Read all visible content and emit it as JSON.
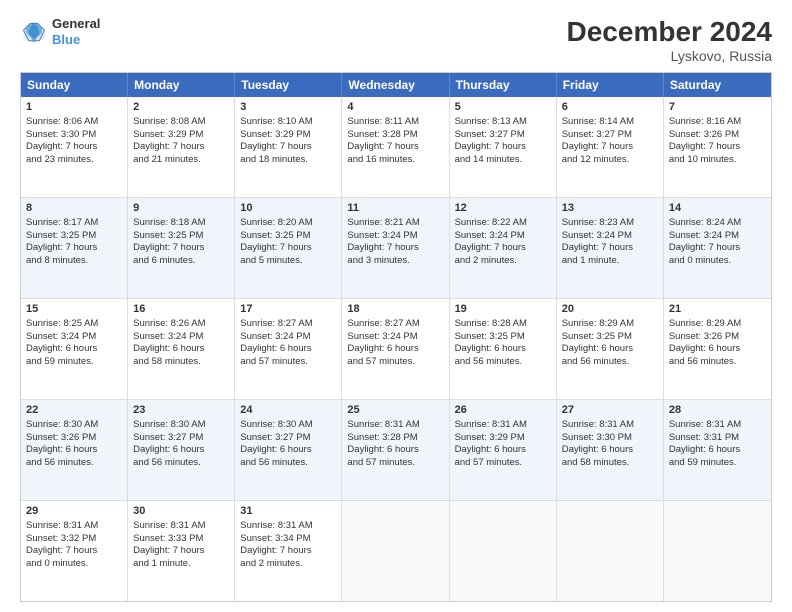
{
  "logo": {
    "line1": "General",
    "line2": "Blue"
  },
  "title": "December 2024",
  "subtitle": "Lyskovo, Russia",
  "headers": [
    "Sunday",
    "Monday",
    "Tuesday",
    "Wednesday",
    "Thursday",
    "Friday",
    "Saturday"
  ],
  "rows": [
    [
      {
        "day": "1",
        "info": "Sunrise: 8:06 AM\nSunset: 3:30 PM\nDaylight: 7 hours\nand 23 minutes."
      },
      {
        "day": "2",
        "info": "Sunrise: 8:08 AM\nSunset: 3:29 PM\nDaylight: 7 hours\nand 21 minutes."
      },
      {
        "day": "3",
        "info": "Sunrise: 8:10 AM\nSunset: 3:29 PM\nDaylight: 7 hours\nand 18 minutes."
      },
      {
        "day": "4",
        "info": "Sunrise: 8:11 AM\nSunset: 3:28 PM\nDaylight: 7 hours\nand 16 minutes."
      },
      {
        "day": "5",
        "info": "Sunrise: 8:13 AM\nSunset: 3:27 PM\nDaylight: 7 hours\nand 14 minutes."
      },
      {
        "day": "6",
        "info": "Sunrise: 8:14 AM\nSunset: 3:27 PM\nDaylight: 7 hours\nand 12 minutes."
      },
      {
        "day": "7",
        "info": "Sunrise: 8:16 AM\nSunset: 3:26 PM\nDaylight: 7 hours\nand 10 minutes."
      }
    ],
    [
      {
        "day": "8",
        "info": "Sunrise: 8:17 AM\nSunset: 3:25 PM\nDaylight: 7 hours\nand 8 minutes."
      },
      {
        "day": "9",
        "info": "Sunrise: 8:18 AM\nSunset: 3:25 PM\nDaylight: 7 hours\nand 6 minutes."
      },
      {
        "day": "10",
        "info": "Sunrise: 8:20 AM\nSunset: 3:25 PM\nDaylight: 7 hours\nand 5 minutes."
      },
      {
        "day": "11",
        "info": "Sunrise: 8:21 AM\nSunset: 3:24 PM\nDaylight: 7 hours\nand 3 minutes."
      },
      {
        "day": "12",
        "info": "Sunrise: 8:22 AM\nSunset: 3:24 PM\nDaylight: 7 hours\nand 2 minutes."
      },
      {
        "day": "13",
        "info": "Sunrise: 8:23 AM\nSunset: 3:24 PM\nDaylight: 7 hours\nand 1 minute."
      },
      {
        "day": "14",
        "info": "Sunrise: 8:24 AM\nSunset: 3:24 PM\nDaylight: 7 hours\nand 0 minutes."
      }
    ],
    [
      {
        "day": "15",
        "info": "Sunrise: 8:25 AM\nSunset: 3:24 PM\nDaylight: 6 hours\nand 59 minutes."
      },
      {
        "day": "16",
        "info": "Sunrise: 8:26 AM\nSunset: 3:24 PM\nDaylight: 6 hours\nand 58 minutes."
      },
      {
        "day": "17",
        "info": "Sunrise: 8:27 AM\nSunset: 3:24 PM\nDaylight: 6 hours\nand 57 minutes."
      },
      {
        "day": "18",
        "info": "Sunrise: 8:27 AM\nSunset: 3:24 PM\nDaylight: 6 hours\nand 57 minutes."
      },
      {
        "day": "19",
        "info": "Sunrise: 8:28 AM\nSunset: 3:25 PM\nDaylight: 6 hours\nand 56 minutes."
      },
      {
        "day": "20",
        "info": "Sunrise: 8:29 AM\nSunset: 3:25 PM\nDaylight: 6 hours\nand 56 minutes."
      },
      {
        "day": "21",
        "info": "Sunrise: 8:29 AM\nSunset: 3:26 PM\nDaylight: 6 hours\nand 56 minutes."
      }
    ],
    [
      {
        "day": "22",
        "info": "Sunrise: 8:30 AM\nSunset: 3:26 PM\nDaylight: 6 hours\nand 56 minutes."
      },
      {
        "day": "23",
        "info": "Sunrise: 8:30 AM\nSunset: 3:27 PM\nDaylight: 6 hours\nand 56 minutes."
      },
      {
        "day": "24",
        "info": "Sunrise: 8:30 AM\nSunset: 3:27 PM\nDaylight: 6 hours\nand 56 minutes."
      },
      {
        "day": "25",
        "info": "Sunrise: 8:31 AM\nSunset: 3:28 PM\nDaylight: 6 hours\nand 57 minutes."
      },
      {
        "day": "26",
        "info": "Sunrise: 8:31 AM\nSunset: 3:29 PM\nDaylight: 6 hours\nand 57 minutes."
      },
      {
        "day": "27",
        "info": "Sunrise: 8:31 AM\nSunset: 3:30 PM\nDaylight: 6 hours\nand 58 minutes."
      },
      {
        "day": "28",
        "info": "Sunrise: 8:31 AM\nSunset: 3:31 PM\nDaylight: 6 hours\nand 59 minutes."
      }
    ],
    [
      {
        "day": "29",
        "info": "Sunrise: 8:31 AM\nSunset: 3:32 PM\nDaylight: 7 hours\nand 0 minutes."
      },
      {
        "day": "30",
        "info": "Sunrise: 8:31 AM\nSunset: 3:33 PM\nDaylight: 7 hours\nand 1 minute."
      },
      {
        "day": "31",
        "info": "Sunrise: 8:31 AM\nSunset: 3:34 PM\nDaylight: 7 hours\nand 2 minutes."
      },
      {
        "day": "",
        "info": ""
      },
      {
        "day": "",
        "info": ""
      },
      {
        "day": "",
        "info": ""
      },
      {
        "day": "",
        "info": ""
      }
    ]
  ]
}
